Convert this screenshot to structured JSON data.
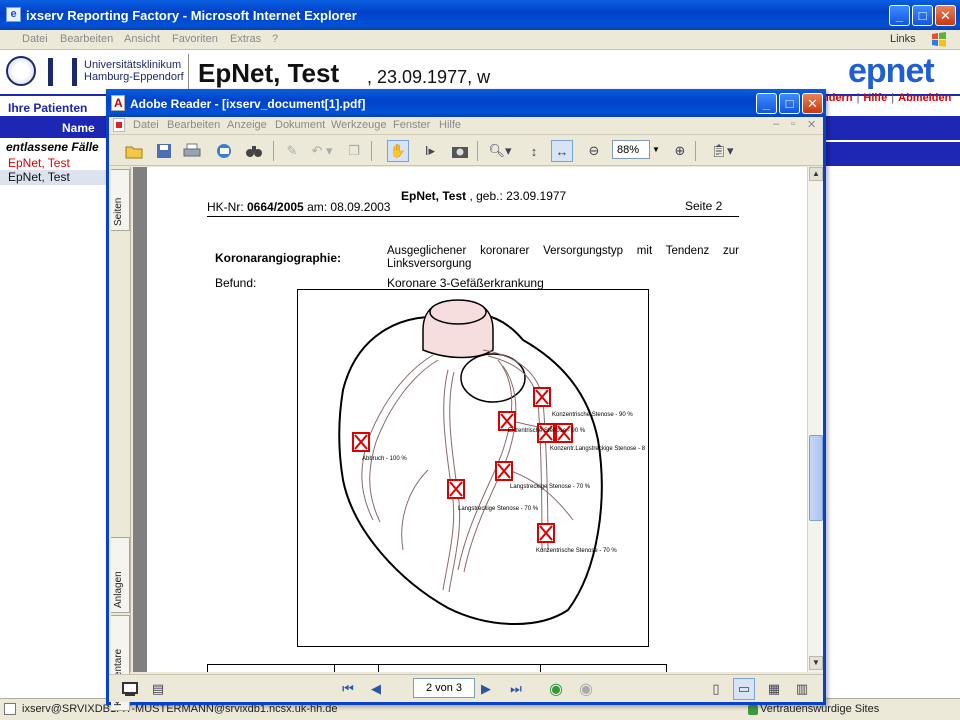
{
  "ie": {
    "title": "ixserv Reporting Factory - Microsoft Internet Explorer",
    "menu": [
      "Datei",
      "Bearbeiten",
      "Ansicht",
      "Favoriten",
      "Extras",
      "?"
    ],
    "links_label": "Links"
  },
  "page": {
    "uke_line1": "Universitätsklinikum",
    "uke_line2": "Hamburg-Eppendorf",
    "patient_name": "EpNet, Test",
    "patient_details": ", 23.09.1977, w",
    "logo": "epnet",
    "top_links": [
      "ndern",
      "Hilfe",
      "Abmelden"
    ],
    "sidebar": {
      "title": "Ihre Patienten",
      "column_header": "Name",
      "section": "entlassene Fälle",
      "items": [
        "EpNet, Test",
        "EpNet, Test"
      ]
    }
  },
  "adobe": {
    "title": "Adobe Reader - [ixserv_document[1].pdf]",
    "menu": [
      "Datei",
      "Bearbeiten",
      "Anzeige",
      "Dokument",
      "Werkzeuge",
      "Fenster",
      "Hilfe"
    ],
    "zoom": "88%",
    "side_tabs": [
      "Seiten",
      "Anlagen",
      "Kommentare"
    ],
    "page_nav": "2 von 3"
  },
  "pdf": {
    "name": "EpNet, Test",
    "dob": " , geb.: 23.09.1977",
    "hk_prefix": "HK-Nr: ",
    "hk_nr": "0664/2005",
    "hk_suffix": " am: 08.09.2003",
    "seite": "Seite 2",
    "koro_label": "Koronarangiographie:",
    "koro_text": "Ausgeglichener koronarer Versorgungstyp mit Tendenz zur Linksversorgung",
    "befund_label": "Befund:",
    "befund_text": "Koronare 3-Gefäßerkrankung",
    "stenoses": [
      "Konzentrische Stenose - 90 %",
      "Exzentrische Stenose - 90 %",
      "Konzentr.Langstreckige Stenose - 8",
      "Abbruch - 100 %",
      "Langstreckige Stenose - 70 %",
      "Langstreckige Stenose - 70 %",
      "Konzentrische Stenose - 70 %"
    ]
  },
  "status": {
    "left": "ixserv@SRVIXDB1: IT-MUSTERMANN@srvixdb1.ncsx.uk-hh.de",
    "right": "Vertrauenswürdige Sites"
  }
}
